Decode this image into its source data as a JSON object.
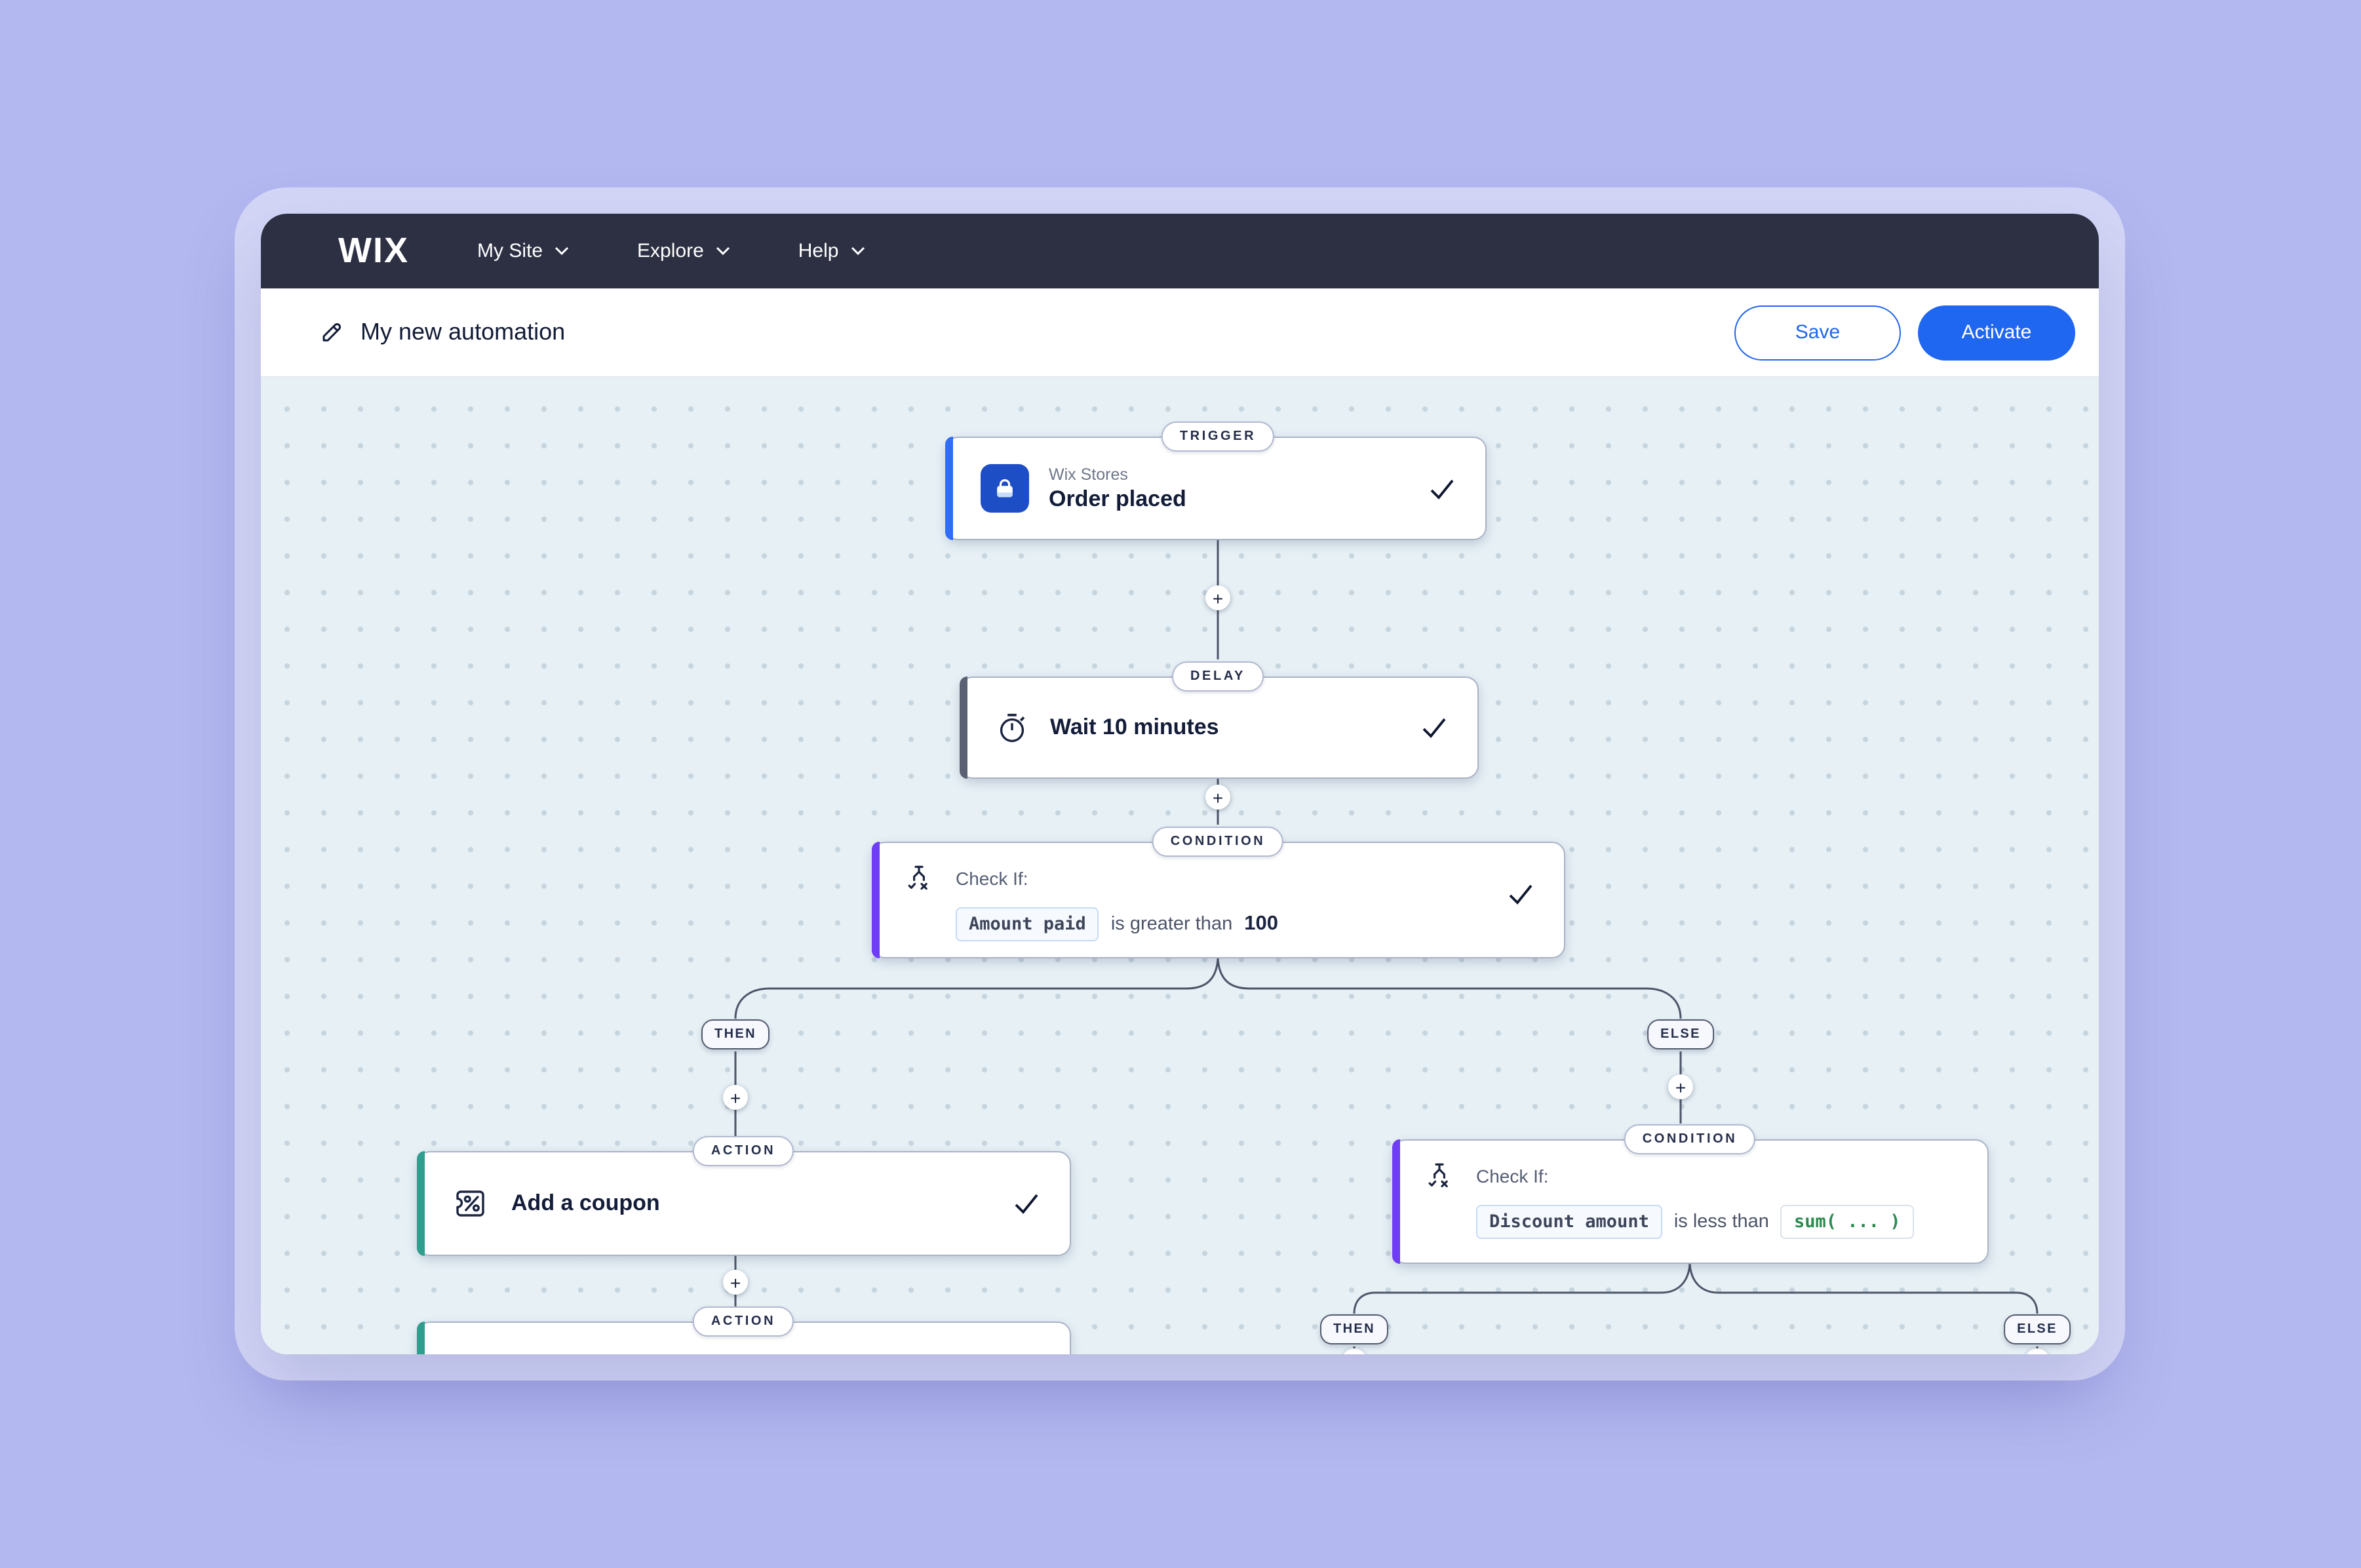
{
  "nav": {
    "logo": "WIX",
    "menu": [
      {
        "label": "My Site"
      },
      {
        "label": "Explore"
      },
      {
        "label": "Help"
      }
    ]
  },
  "header": {
    "title": "My new automation",
    "save_label": "Save",
    "activate_label": "Activate"
  },
  "flow": {
    "add_step_label": "+",
    "trigger": {
      "badge": "TRIGGER",
      "app": "Wix Stores",
      "title": "Order placed",
      "status": "completed"
    },
    "delay": {
      "badge": "DELAY",
      "title": "Wait 10 minutes",
      "status": "completed"
    },
    "condition1": {
      "badge": "CONDITION",
      "prompt": "Check If:",
      "field": "Amount paid",
      "operator": "is greater than",
      "value": "100",
      "status": "completed"
    },
    "branch1": {
      "then_label": "THEN",
      "else_label": "ELSE"
    },
    "action1": {
      "badge": "ACTION",
      "title": "Add a coupon",
      "status": "completed"
    },
    "action2": {
      "badge": "ACTION"
    },
    "condition2": {
      "badge": "CONDITION",
      "prompt": "Check If:",
      "field": "Discount amount",
      "operator": "is less than",
      "value": "sum( ... )"
    },
    "branch2": {
      "then_label": "THEN",
      "else_label": "ELSE"
    }
  },
  "colors": {
    "page_background": "#b4b8f0",
    "navbar": "#2d3042",
    "primary_blue": "#1f66f0",
    "canvas_background": "#e6f0f5",
    "trigger_accent": "#2f6df4",
    "delay_accent": "#5b6172",
    "condition_accent": "#6e3df5",
    "action_accent": "#2f9e8f",
    "formula_green": "#2a8a4e"
  }
}
